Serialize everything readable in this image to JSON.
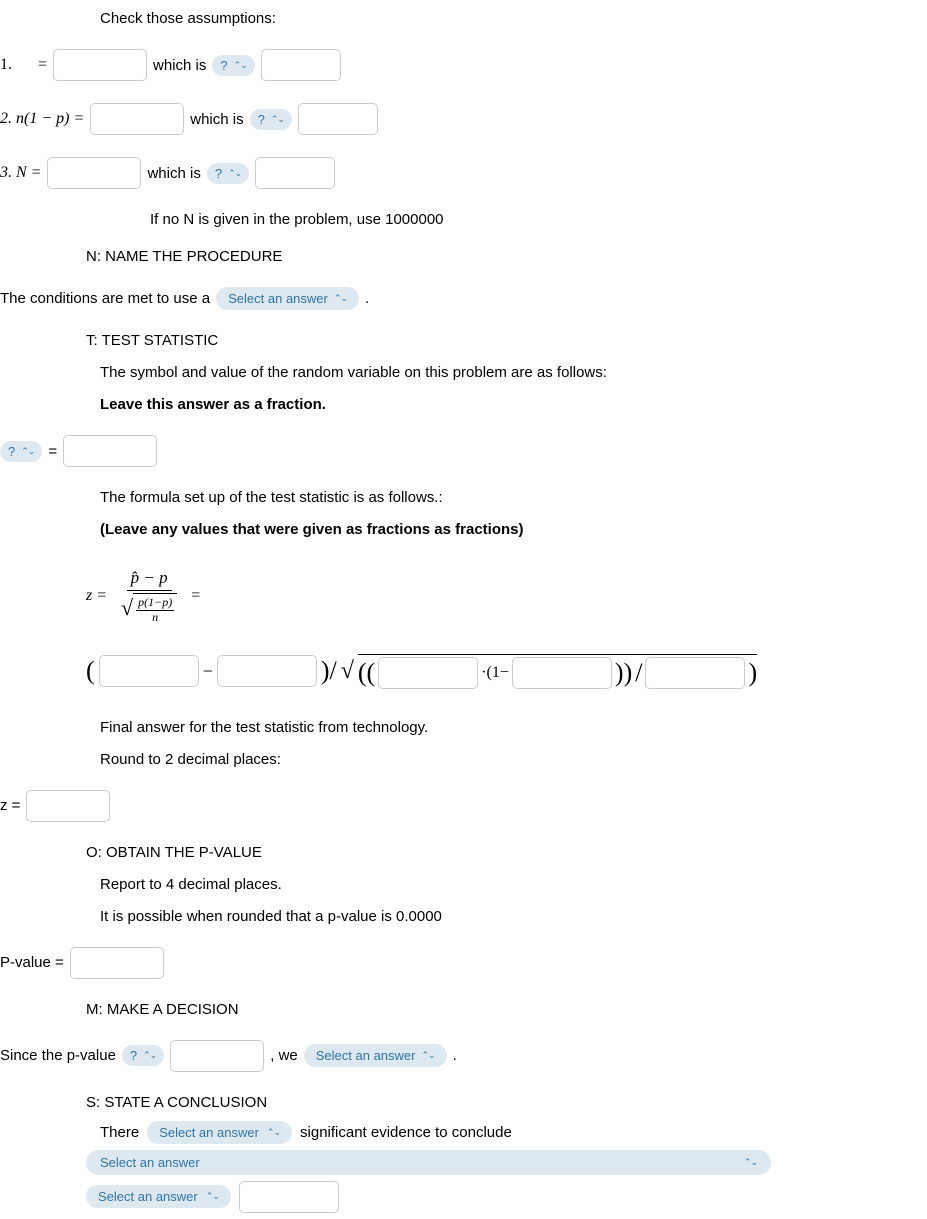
{
  "heading": "Check those assumptions:",
  "assump": {
    "a1_num": "1.",
    "a1_eq": "=",
    "a1_which": "which is",
    "a2_label": "2. n(1 − p) =",
    "a2_which": "which is",
    "a3_label": "3. N =",
    "a3_which": "which is",
    "note": "If no N is given in the problem, use 1000000"
  },
  "qmark": "?",
  "updown": "⇅",
  "N": {
    "title": "N: NAME THE PROCEDURE",
    "text_a": "The conditions are met to use a",
    "select": "Select an answer",
    "dot": "."
  },
  "T": {
    "title": "T: TEST STATISTIC",
    "line1": "The symbol and value of the random variable on this problem are as follows:",
    "bold": "Leave this answer as a fraction.",
    "eq": "=",
    "line2": "The formula set up of the test statistic is as follows.:",
    "bold2": "(Leave any values that were given as fractions as fractions)",
    "z_eq": "z =",
    "phat_p": "p̂ − p",
    "p1p": "p(1−p)",
    "n": "n",
    "eqsign": "=",
    "open": "(",
    "minus": "−",
    "closediv": ")/",
    "sqrt": "√",
    "dpar": "((",
    "mid": "·(1−",
    "close2": "))",
    "slash": "/",
    "closef": ")",
    "final": "Final answer for the test statistic from technology.",
    "round": "Round to 2 decimal places:",
    "zlabel": "z ="
  },
  "O": {
    "title": "O: OBTAIN THE P-VALUE",
    "line1": "Report to 4 decimal places.",
    "line2": "It is possible when rounded that a p-value is 0.0000",
    "plabel": "P-value ="
  },
  "M": {
    "title": "M: MAKE A DECISION",
    "since": "Since the p-value",
    "comma": ", we",
    "select": "Select an answer",
    "dot": "."
  },
  "S": {
    "title": "S: STATE A CONCLUSION",
    "there": "There",
    "select": "Select an answer",
    "evidence": "significant evidence to conclude",
    "select2": "Select an answer",
    "select3": "Select an answer"
  }
}
